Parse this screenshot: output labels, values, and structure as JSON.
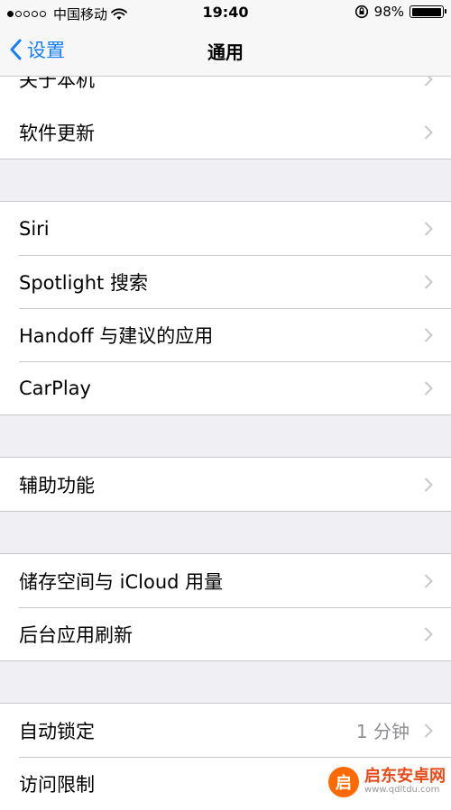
{
  "status_bar": {
    "carrier": "中国移动",
    "time": "19:40",
    "battery_percent": "98%",
    "battery_level": 0.98,
    "signal_bars": 1
  },
  "nav": {
    "back_label": "设置",
    "title": "通用"
  },
  "groups": [
    {
      "items": [
        {
          "label": "关于本机"
        },
        {
          "label": "软件更新"
        }
      ]
    },
    {
      "items": [
        {
          "label": "Siri"
        },
        {
          "label": "Spotlight 搜索"
        },
        {
          "label": "Handoff 与建议的应用"
        },
        {
          "label": "CarPlay"
        }
      ]
    },
    {
      "items": [
        {
          "label": "辅助功能"
        }
      ]
    },
    {
      "items": [
        {
          "label": "储存空间与 iCloud 用量"
        },
        {
          "label": "后台应用刷新"
        }
      ]
    },
    {
      "items": [
        {
          "label": "自动锁定",
          "value": "1 分钟"
        },
        {
          "label": "访问限制"
        }
      ]
    }
  ],
  "watermark": {
    "name": "启东安卓网",
    "url": "www.qdltdu.com"
  },
  "colors": {
    "accent": "#147efb",
    "background": "#efeff4",
    "separator": "#c8c7cc",
    "chevron": "#c7c7cc",
    "secondary_text": "#8e8e93"
  }
}
